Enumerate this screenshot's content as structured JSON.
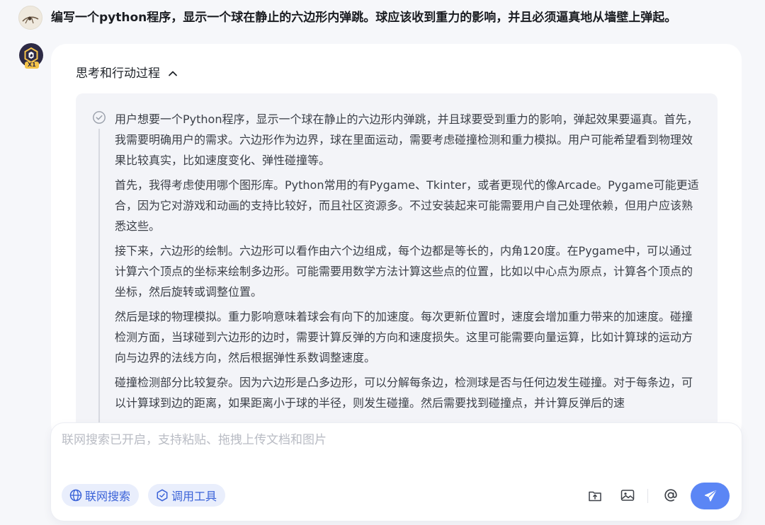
{
  "user_message": {
    "text": "编写一个python程序，显示一个球在静止的六边形内弹跳。球应该收到重力的影响，并且必须逼真地从墙壁上弹起。"
  },
  "assistant": {
    "badge": "X1",
    "thinking": {
      "title": "思考和行动过程",
      "paragraphs": [
        "用户想要一个Python程序，显示一个球在静止的六边形内弹跳，并且球要受到重力的影响，弹起效果要逼真。首先，我需要明确用户的需求。六边形作为边界，球在里面运动，需要考虑碰撞检测和重力模拟。用户可能希望看到物理效果比较真实，比如速度变化、弹性碰撞等。",
        "首先，我得考虑使用哪个图形库。Python常用的有Pygame、Tkinter，或者更现代的像Arcade。Pygame可能更适合，因为它对游戏和动画的支持比较好，而且社区资源多。不过安装起来可能需要用户自己处理依赖，但用户应该熟悉这些。",
        "接下来，六边形的绘制。六边形可以看作由六个边组成，每个边都是等长的，内角120度。在Pygame中，可以通过计算六个顶点的坐标来绘制多边形。可能需要用数学方法计算这些点的位置，比如以中心点为原点，计算各个顶点的坐标，然后旋转或调整位置。",
        "然后是球的物理模拟。重力影响意味着球会有向下的加速度。每次更新位置时，速度会增加重力带来的加速度。碰撞检测方面，当球碰到六边形的边时，需要计算反弹的方向和速度损失。这里可能需要向量运算，比如计算球的运动方向与边界的法线方向，然后根据弹性系数调整速度。",
        "碰撞检测部分比较复杂。因为六边形是凸多边形，可以分解每条边，检测球是否与任何边发生碰撞。对于每条边，可以计算球到边的距离，如果距离小于球的半径，则发生碰撞。然后需要找到碰撞点，并计算反弹后的速"
      ]
    }
  },
  "composer": {
    "placeholder": "联网搜索已开启，支持粘贴、拖拽上传文档和图片",
    "web_search_label": "联网搜索",
    "tools_label": "调用工具"
  },
  "colors": {
    "accent": "#5b86f5",
    "pill_bg": "#e9eefc",
    "pill_text": "#3a62d8",
    "page_bg": "#f6f7fa"
  },
  "icons": [
    "user-avatar",
    "assistant-logo-icon",
    "chevron-up-icon",
    "check-circle-icon",
    "globe-icon",
    "tool-icon",
    "upload-icon",
    "image-icon",
    "at-icon",
    "send-icon"
  ]
}
